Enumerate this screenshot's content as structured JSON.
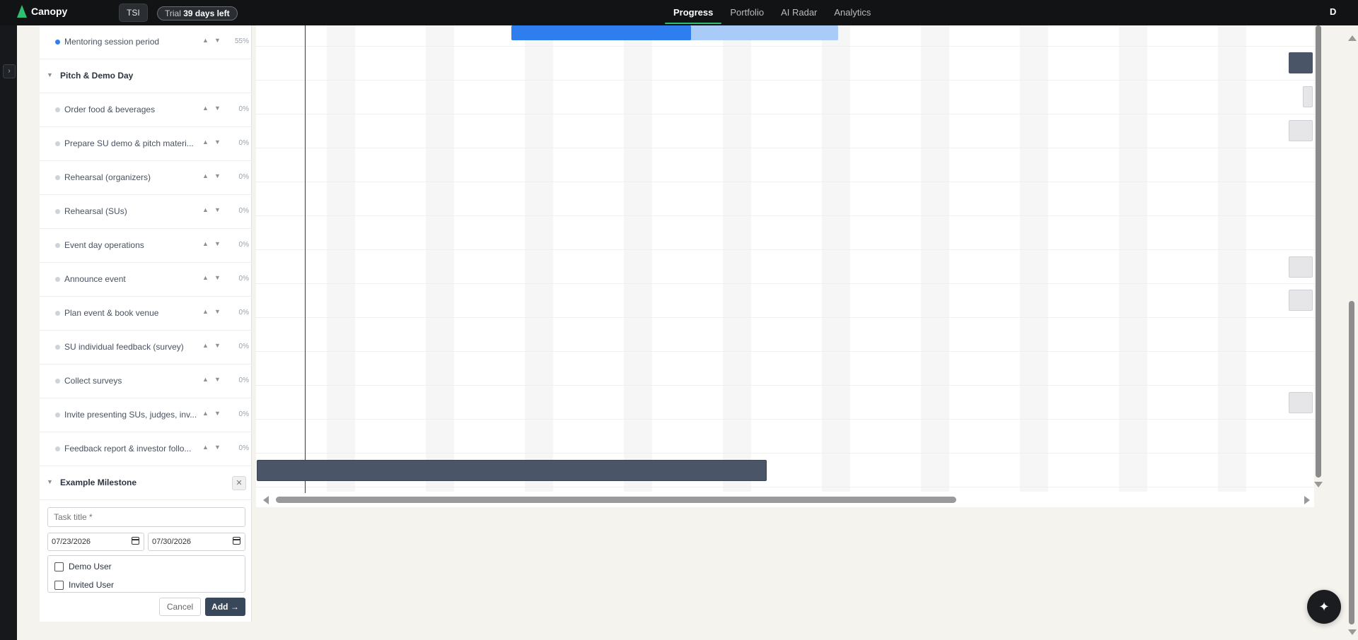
{
  "app": {
    "name": "Canopy",
    "org": "TSI",
    "trial_prefix": "Trial",
    "trial_days": "39 days left",
    "user_initial": "D"
  },
  "nav": {
    "tabs": [
      {
        "label": "Progress"
      },
      {
        "label": "Portfolio"
      },
      {
        "label": "AI Radar"
      },
      {
        "label": "Analytics"
      }
    ],
    "active": "Progress"
  },
  "rail": {
    "toggle": "›"
  },
  "tasks": {
    "top_row": {
      "label": "Mentoring session period",
      "pct": "55%"
    },
    "group_pitch": {
      "title": "Pitch & Demo Day"
    },
    "rows": [
      {
        "label": "Order food & beverages",
        "pct": "0%"
      },
      {
        "label": "Prepare SU demo & pitch materi...",
        "pct": "0%"
      },
      {
        "label": "Rehearsal (organizers)",
        "pct": "0%"
      },
      {
        "label": "Rehearsal (SUs)",
        "pct": "0%"
      },
      {
        "label": "Event day operations",
        "pct": "0%"
      },
      {
        "label": "Announce event",
        "pct": "0%"
      },
      {
        "label": "Plan event & book venue",
        "pct": "0%"
      },
      {
        "label": "SU individual feedback (survey)",
        "pct": "0%"
      },
      {
        "label": "Collect surveys",
        "pct": "0%"
      },
      {
        "label": "Invite presenting SUs, judges, inv...",
        "pct": "0%"
      },
      {
        "label": "Feedback report & investor follo...",
        "pct": "0%"
      }
    ],
    "group_example": {
      "title": "Example Milestone",
      "close": "✕"
    },
    "up_glyph": "▲",
    "down_glyph": "▼",
    "caret_glyph": "▼"
  },
  "form": {
    "title_placeholder": "Task title *",
    "start_date": "07/23/2026",
    "end_date": "07/30/2026",
    "assignees": [
      {
        "name": "Demo User"
      },
      {
        "name": "Invited User"
      }
    ],
    "cancel_label": "Cancel",
    "add_label": "Add →"
  },
  "colors": {
    "accent": "#2fbf71",
    "progress_blue": "#2f7ef0",
    "progress_light": "#a8ccf7",
    "bar_dark": "#4a5568",
    "bar_grey": "#e6e6e8"
  },
  "fab": {
    "icon": "✦"
  }
}
